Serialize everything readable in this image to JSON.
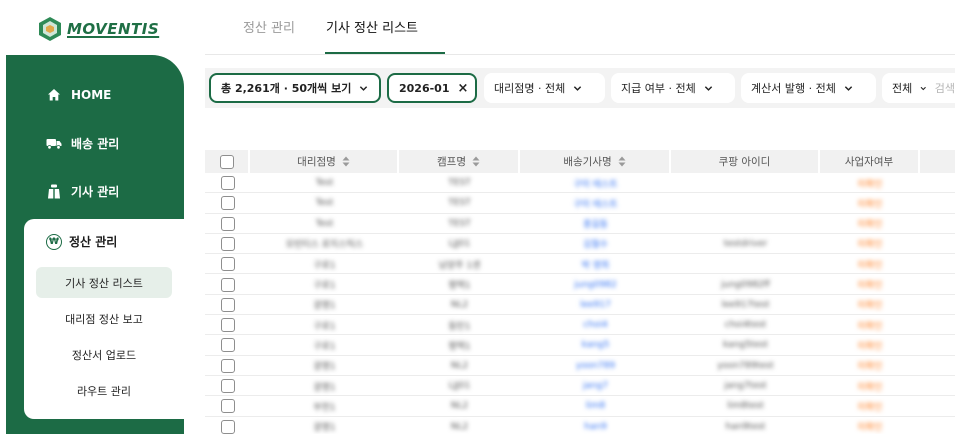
{
  "brand": {
    "name": "MOVENTIS",
    "accent": "#1c6b45"
  },
  "sidebar": {
    "items": [
      {
        "label": "HOME",
        "icon": "home-icon"
      },
      {
        "label": "배송 관리",
        "icon": "truck-icon"
      },
      {
        "label": "기사 관리",
        "icon": "driver-icon"
      }
    ],
    "settlement": {
      "label": "정산 관리",
      "icon": "won-icon",
      "icon_glyph": "₩",
      "subitems": [
        "기사 정산 리스트",
        "대리점 정산 보고",
        "정산서 업로드",
        "라우트 관리"
      ]
    }
  },
  "tabs": [
    "정산 관리",
    "기사 정산 리스트"
  ],
  "filters": {
    "count_chip": "총 2,261개 · 50개씩 보기",
    "month_chip": "2026-01",
    "agency": "대리점명 · 전체",
    "payment": "지급 여부 · 전체",
    "invoice": "계산서 발행 · 전체",
    "all": "전체",
    "search_placeholder": "검색"
  },
  "table": {
    "headers": [
      "대리점명",
      "캠프명",
      "배송기사명",
      "쿠팡 아이디",
      "사업자여부"
    ],
    "rows": [
      [
        "Test",
        "TEST",
        "구미 테스트",
        "",
        "미확인"
      ],
      [
        "Test",
        "TEST",
        "구미 테스트",
        "",
        "미확인"
      ],
      [
        "Test",
        "TEST",
        "홍길동",
        "",
        "미확인"
      ],
      [
        "모빈티스 로지스틱스",
        "LJJ01",
        "김철수",
        "testdriver",
        "미확인"
      ],
      [
        "구로1",
        "남양주 1센",
        "박 영희",
        "",
        "미확인"
      ],
      [
        "구로1",
        "평택1",
        "jung0982",
        "jung0982ff",
        "미확인"
      ],
      [
        "광명1",
        "NL2",
        "lee917",
        "lee917test",
        "미확인"
      ],
      [
        "구로1",
        "동탄1",
        "choi4",
        "choi4test",
        "미확인"
      ],
      [
        "구로1",
        "평택1",
        "kang5",
        "kang5test",
        "미확인"
      ],
      [
        "광명1",
        "NL2",
        "yoon789",
        "yoon789test",
        "미확인"
      ],
      [
        "광명1",
        "LJJ01",
        "jang7",
        "jang7test",
        "미확인"
      ],
      [
        "부천1",
        "NL2",
        "lim8",
        "lim8test",
        "미확인"
      ],
      [
        "광명1",
        "NL2",
        "han9",
        "han9test",
        "미확인"
      ]
    ]
  }
}
